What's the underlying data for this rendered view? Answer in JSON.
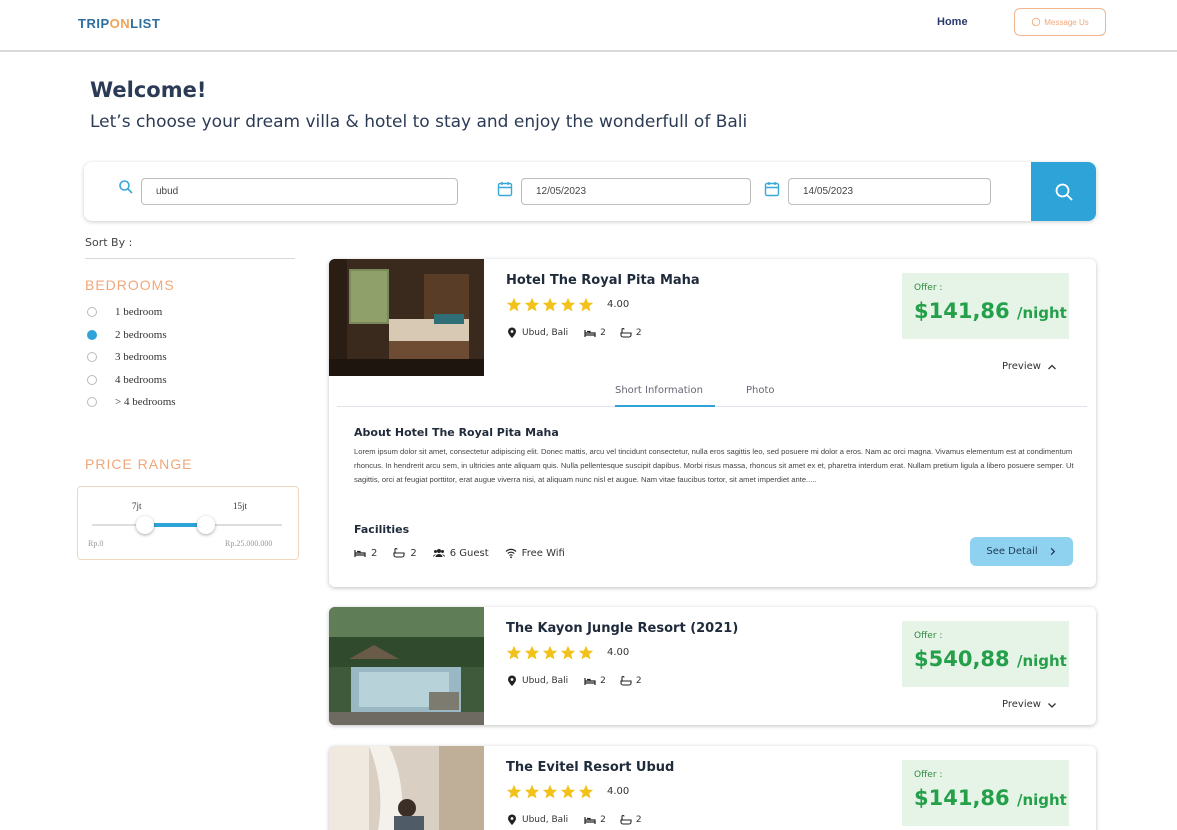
{
  "header": {
    "logo_parts": [
      "TRIP",
      "ON",
      "LIST"
    ],
    "nav_home": "Home",
    "message_button": "Message Us"
  },
  "welcome": {
    "title": "Welcome!",
    "subtitle": "Let’s choose your dream villa & hotel  to stay and enjoy the wonderfull of Bali"
  },
  "search": {
    "location_value": "ubud",
    "checkin_value": "12/05/2023",
    "checkout_value": "14/05/2023"
  },
  "filters": {
    "sort_by": "Sort By :",
    "bedrooms_title": "BEDROOMS",
    "bedroom_options": [
      "1 bedroom",
      "2 bedrooms",
      "3 bedrooms",
      "4 bedrooms",
      "> 4 bedrooms"
    ],
    "selected_bedroom": "2 bedrooms",
    "price_title": "PRICE RANGE",
    "price_low_label": "7jt",
    "price_high_label": "15jt",
    "price_min": "Rp.0",
    "price_max": "Rp.25.000.000",
    "price_low_fraction": 0.28,
    "price_high_fraction": 0.6
  },
  "hotels": [
    {
      "name": "Hotel The Royal Pita Maha",
      "rating": "4.00",
      "location": "Ubud, Bali",
      "beds": "2",
      "baths": "2",
      "offer_label": "Offer :",
      "price": "$141,86",
      "price_unit": "/night",
      "preview_label": "Preview",
      "expanded": true,
      "tabs": [
        "Short Information",
        "Photo"
      ],
      "about_title": "About Hotel The Royal Pita Maha",
      "about_text": "Lorem ipsum dolor sit amet, consectetur adipiscing elit. Donec mattis, arcu vel tincidunt consectetur, nulla eros sagittis leo, sed posuere mi dolor a eros. Nam ac orci magna. Vivamus elementum est at condimentum rhoncus. In hendrerit arcu sem, in ultricies ante aliquam quis. Nulla pellentesque suscipit dapibus. Morbi risus massa, rhoncus sit amet ex et, pharetra interdum erat. Nullam pretium ligula a libero posuere semper. Ut sagittis, orci at feugiat porttitor, erat augue viverra nisi, at aliquam nunc nisl et augue. Nam vitae faucibus tortor, sit amet imperdiet ante.....",
      "facilities_title": "Facilities",
      "facilities": {
        "beds": "2",
        "baths": "2",
        "guests": "6 Guest",
        "wifi": "Free Wifi"
      },
      "detail_button": "See Detail"
    },
    {
      "name": "The Kayon Jungle Resort (2021)",
      "rating": "4.00",
      "location": "Ubud, Bali",
      "beds": "2",
      "baths": "2",
      "offer_label": "Offer :",
      "price": "$540,88",
      "price_unit": "/night",
      "preview_label": "Preview",
      "expanded": false
    },
    {
      "name": "The Evitel Resort Ubud",
      "rating": "4.00",
      "location": "Ubud, Bali",
      "beds": "2",
      "baths": "2",
      "offer_label": "Offer :",
      "price": "$141,86",
      "price_unit": "/night",
      "expanded": false
    }
  ],
  "colors": {
    "accent_blue": "#2ea3d8",
    "accent_orange": "#f0a77a",
    "price_green": "#24a04a",
    "star_yellow": "#f2c21b"
  }
}
